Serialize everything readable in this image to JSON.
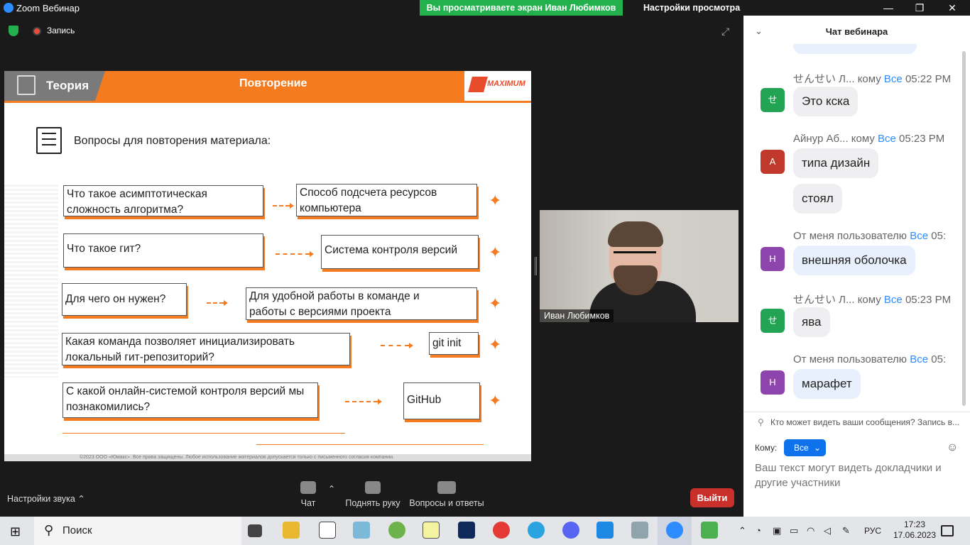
{
  "window": {
    "title": "Zoom Вебинар",
    "share_banner": "Вы просматриваете экран Иван Любимков",
    "view_settings": "Настройки просмотра ⌄",
    "controls": {
      "minimize": "—",
      "restore": "❐",
      "close": "✕"
    }
  },
  "meeting": {
    "record_label": "Запись",
    "fullscreen_icon": "⤢",
    "presenter_name": "Иван Любимков",
    "sound_settings": "Настройки звука  ⌃",
    "toolbar": {
      "chat": "Чат",
      "raise_hand": "Поднять руку",
      "qa": "Вопросы и ответы",
      "exit": "Выйти"
    }
  },
  "slide": {
    "section": "Теория",
    "header": "Повторение",
    "logo": "MAXIMUM",
    "subtitle": "Вопросы для повторения материала:",
    "rows": [
      {
        "q": "Что такое асимптотическая сложность алгоритма?",
        "a": "Способ подсчета ресурсов компьютера"
      },
      {
        "q": "Что такое гит?",
        "a": "Система контроля версий"
      },
      {
        "q": "Для чего он нужен?",
        "a": "Для удобной работы в команде и работы с версиями проекта"
      },
      {
        "q": "Какая команда позволяет инициализировать локальный гит-репозиторий?",
        "a": "git init"
      },
      {
        "q": "С какой онлайн-системой контроля версий мы познакомились?",
        "a": "GitHub"
      }
    ],
    "star": "✦",
    "footer": "©2023 ООО «Юмакс». Все права защищены. Любое использование материалов допускается только с письменного согласия компании."
  },
  "chat": {
    "title": "Чат вебинара",
    "messages": [
      {
        "sender": "せんせい Л...",
        "kw": "кому",
        "to": "Все",
        "time": "05:22 PM",
        "avatar": "せ",
        "avatar_color": "#23a455",
        "texts": [
          "Это кска"
        ],
        "style": "grey"
      },
      {
        "sender": "Айнур Аб...",
        "kw": "кому",
        "to": "Все",
        "time": "05:23 PM",
        "avatar": "А",
        "avatar_color": "#c0392b",
        "texts": [
          "типа дизайн",
          "стоял"
        ],
        "style": "grey"
      },
      {
        "sender": "От меня пользователю",
        "kw": "",
        "to": "Все",
        "time": "05:",
        "avatar": "Н",
        "avatar_color": "#8e44ad",
        "texts": [
          "внешняя оболочка"
        ],
        "style": "blue"
      },
      {
        "sender": "せんせい Л...",
        "kw": "кому",
        "to": "Все",
        "time": "05:23 PM",
        "avatar": "せ",
        "avatar_color": "#23a455",
        "texts": [
          "ява"
        ],
        "style": "grey"
      },
      {
        "sender": "От меня пользователю",
        "kw": "",
        "to": "Все",
        "time": "05:",
        "avatar": "Н",
        "avatar_color": "#8e44ad",
        "texts": [
          "марафет"
        ],
        "style": "blue"
      }
    ],
    "privacy_note": "Кто может видеть ваши сообщения? Запись в...",
    "to_label": "Кому:",
    "to_value": "Все",
    "input_placeholder": "Ваш текст могут видеть докладчики и другие участники"
  },
  "taskbar": {
    "search_label": "Поиск",
    "lang": "РУС",
    "time": "17:23",
    "date": "17.06.2023"
  }
}
